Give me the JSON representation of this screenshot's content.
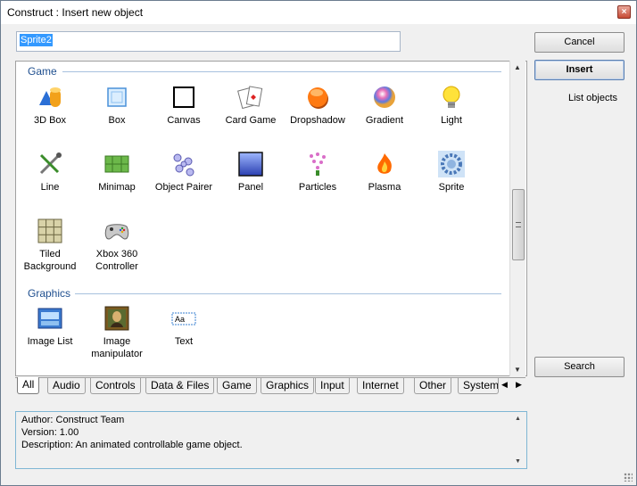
{
  "window": {
    "title": "Construct : Insert new object",
    "close_glyph": "×"
  },
  "name_input": {
    "value": "Sprite2"
  },
  "buttons": {
    "cancel": "Cancel",
    "insert": "Insert",
    "list_objects": "List objects",
    "search": "Search"
  },
  "sections": [
    {
      "title": "Game",
      "items": [
        {
          "label": "3D Box",
          "icon": "3d-box-icon"
        },
        {
          "label": "Box",
          "icon": "box-icon"
        },
        {
          "label": "Canvas",
          "icon": "canvas-icon"
        },
        {
          "label": "Card Game",
          "icon": "card-game-icon"
        },
        {
          "label": "Dropshadow",
          "icon": "dropshadow-icon"
        },
        {
          "label": "Gradient",
          "icon": "gradient-icon"
        },
        {
          "label": "Light",
          "icon": "light-bulb-icon"
        },
        {
          "label": "Line",
          "icon": "line-tools-icon"
        },
        {
          "label": "Minimap",
          "icon": "minimap-icon"
        },
        {
          "label": "Object Pairer",
          "icon": "object-pairer-icon"
        },
        {
          "label": "Panel",
          "icon": "panel-icon"
        },
        {
          "label": "Particles",
          "icon": "particles-icon"
        },
        {
          "label": "Plasma",
          "icon": "plasma-icon"
        },
        {
          "label": "Sprite",
          "icon": "sprite-icon",
          "selected": true
        },
        {
          "label": "Tiled Background",
          "icon": "tiled-background-icon"
        },
        {
          "label": "Xbox 360 Controller",
          "icon": "xbox-controller-icon"
        }
      ]
    },
    {
      "title": "Graphics",
      "items": [
        {
          "label": "Image List",
          "icon": "image-list-icon"
        },
        {
          "label": "Image manipulator",
          "icon": "image-manipulator-icon"
        },
        {
          "label": "Text",
          "icon": "text-icon",
          "icon_text": "Aa"
        }
      ]
    }
  ],
  "tabs": [
    "All",
    "Audio",
    "Controls",
    "Data & Files",
    "Game",
    "Graphics",
    "Input",
    "Internet",
    "Other",
    "System"
  ],
  "active_tab": "All",
  "description": {
    "author": "Author: Construct Team",
    "version": "Version: 1.00",
    "description": "Description: An animated controllable game object."
  },
  "colors": {
    "section_title": "#1f4f8f",
    "selection": "#3399ff"
  }
}
